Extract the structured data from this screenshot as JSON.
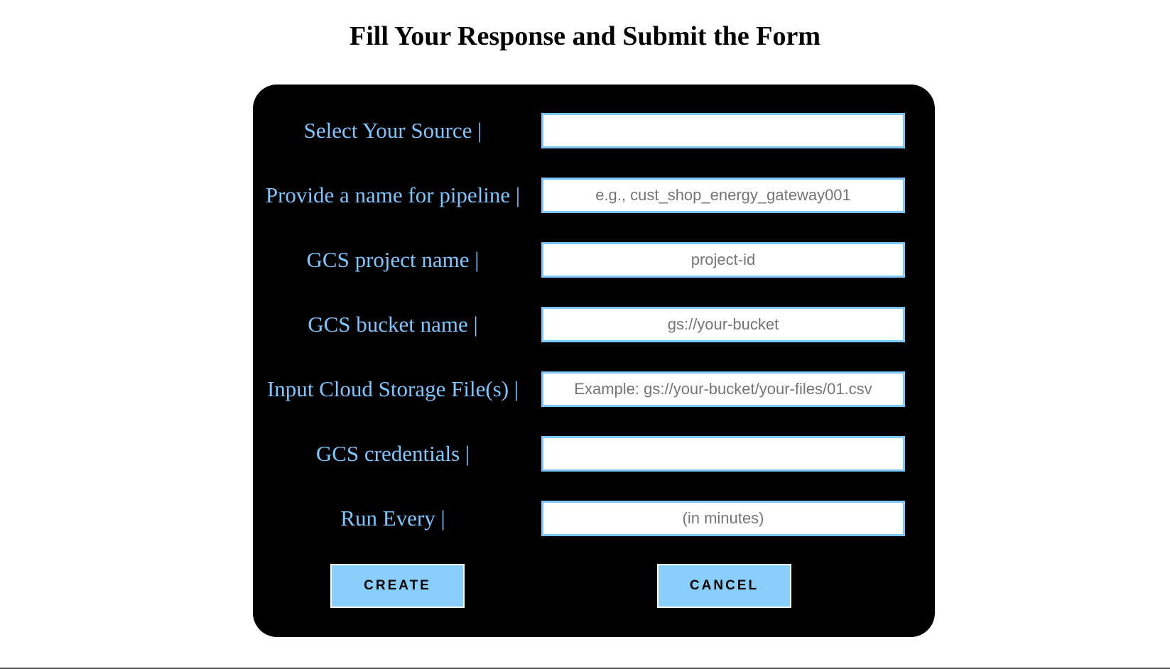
{
  "page": {
    "title": "Fill Your Response and Submit the Form"
  },
  "form": {
    "fields": [
      {
        "label": "Select Your Source |",
        "placeholder": "",
        "value": ""
      },
      {
        "label": "Provide a name for pipeline |",
        "placeholder": "e.g., cust_shop_energy_gateway001",
        "value": ""
      },
      {
        "label": "GCS project name |",
        "placeholder": "project-id",
        "value": ""
      },
      {
        "label": "GCS bucket name |",
        "placeholder": "gs://your-bucket",
        "value": ""
      },
      {
        "label": "Input Cloud Storage File(s) |",
        "placeholder": "Example: gs://your-bucket/your-files/01.csv",
        "value": ""
      },
      {
        "label": "GCS credentials |",
        "placeholder": "",
        "value": ""
      },
      {
        "label": "Run Every |",
        "placeholder": "(in minutes)",
        "value": ""
      }
    ],
    "buttons": {
      "create_label": "CREATE",
      "cancel_label": "CANCEL"
    }
  },
  "colors": {
    "card_background": "#000000",
    "label_text": "#7cc7ff",
    "input_border": "#7cc7ff",
    "button_background": "#87cefa"
  }
}
